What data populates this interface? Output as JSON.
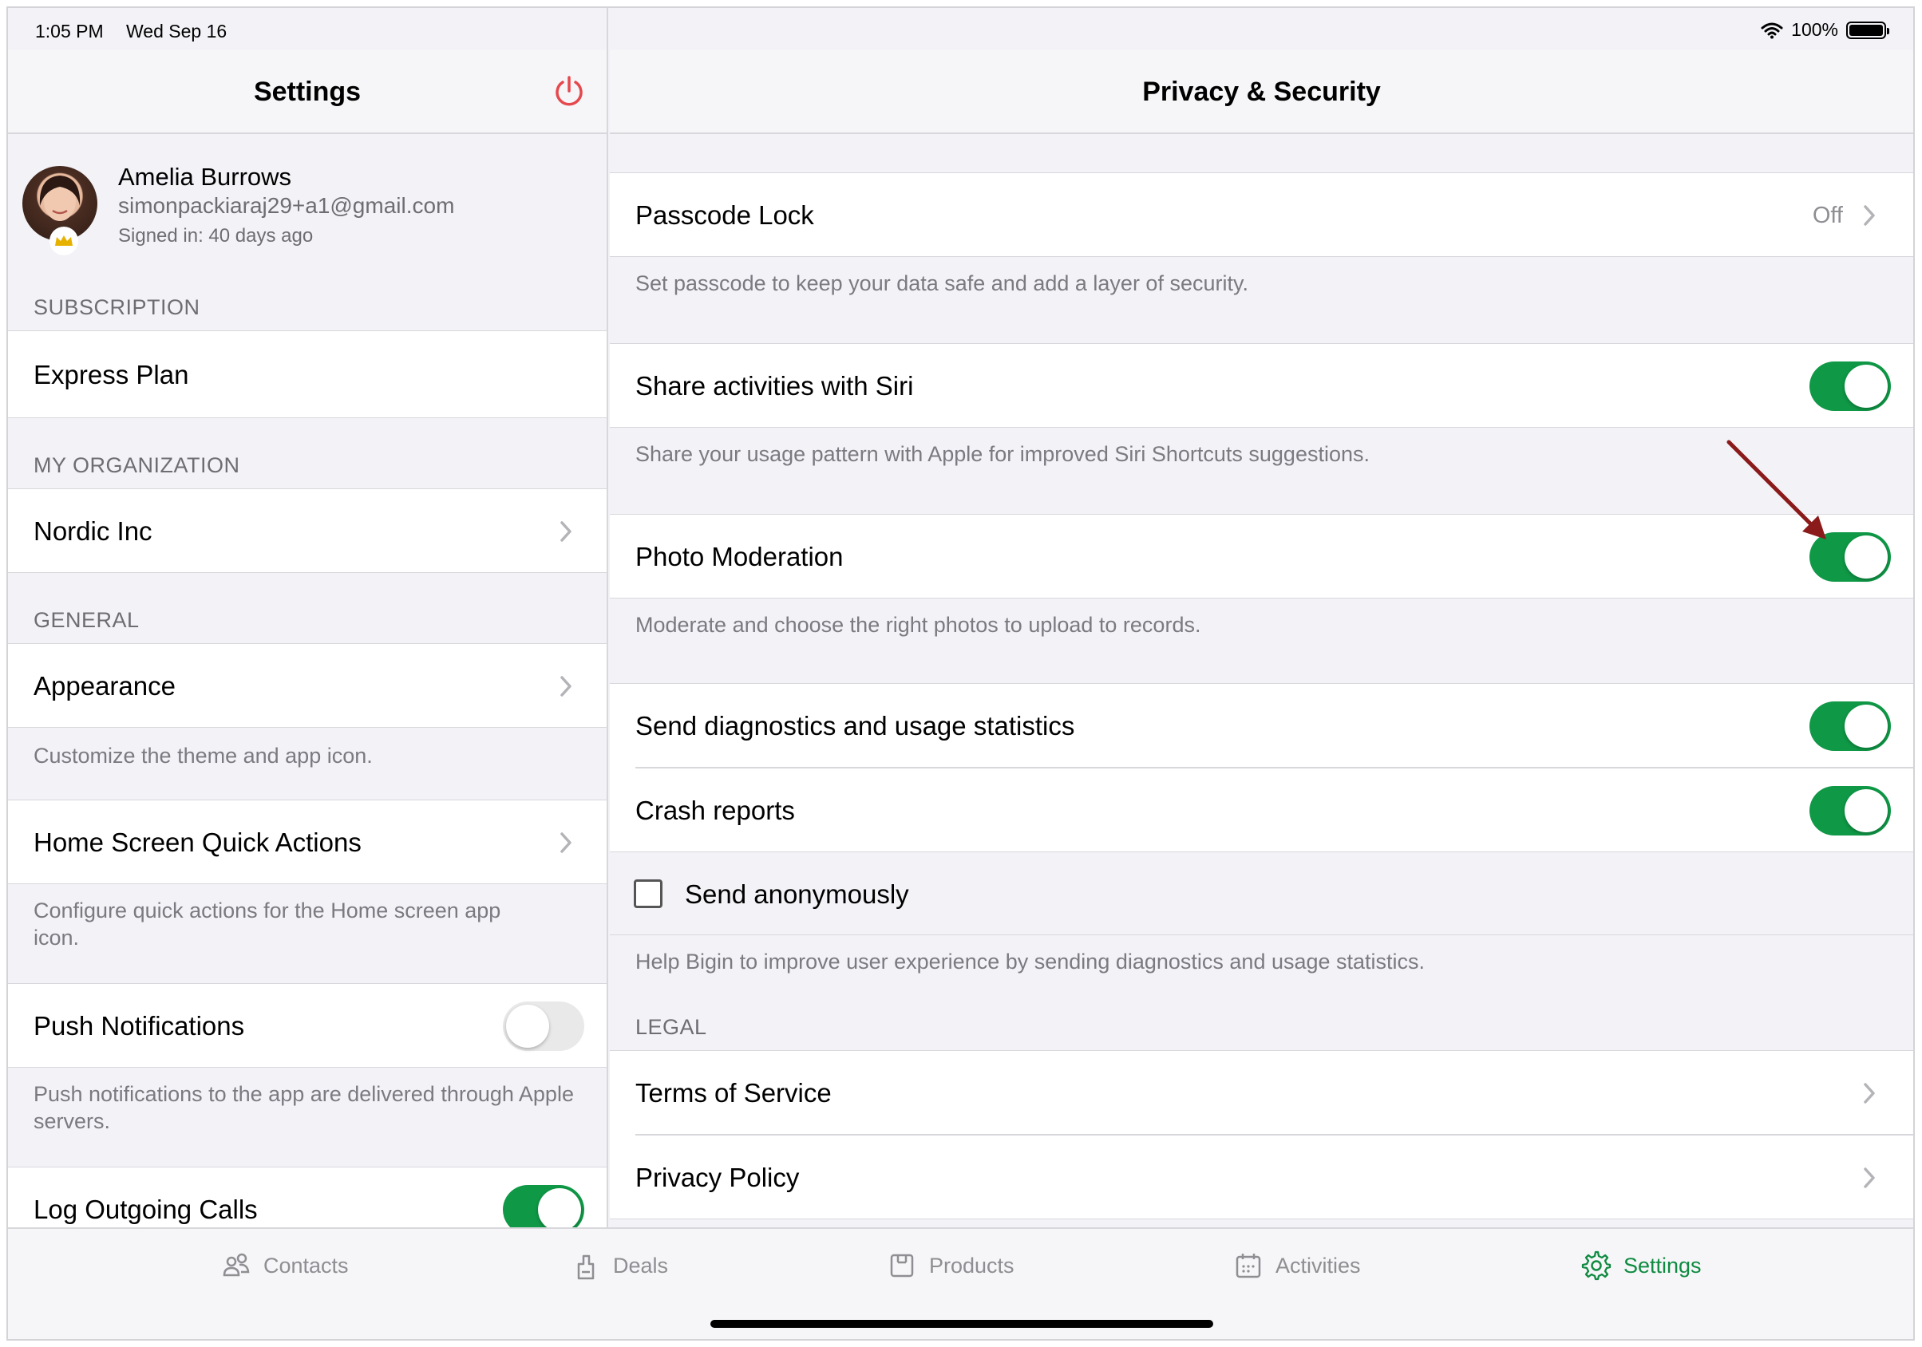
{
  "status_bar": {
    "time": "1:05 PM",
    "date": "Wed Sep 16",
    "battery": "100%"
  },
  "left": {
    "title": "Settings",
    "profile": {
      "name": "Amelia Burrows",
      "email": "simonpackiaraj29+a1@gmail.com",
      "signed_in": "Signed in: 40 days ago"
    },
    "subscription_header": "SUBSCRIPTION",
    "subscription_plan": "Express Plan",
    "org_header": "MY ORGANIZATION",
    "org_name": "Nordic Inc",
    "general_header": "GENERAL",
    "appearance": "Appearance",
    "appearance_footer": "Customize the theme and app icon.",
    "quick_actions": "Home Screen Quick Actions",
    "quick_actions_footer": "Configure quick actions for the Home screen app icon.",
    "push": "Push Notifications",
    "push_toggle": "off",
    "push_footer": "Push notifications to the app are delivered through Apple servers.",
    "log_calls": "Log Outgoing Calls",
    "log_calls_toggle": "on"
  },
  "right": {
    "title": "Privacy & Security",
    "passcode_label": "Passcode Lock",
    "passcode_value": "Off",
    "passcode_footer": "Set passcode to keep your data safe and add a layer of security.",
    "siri_label": "Share activities with Siri",
    "siri_toggle": "on",
    "siri_footer": "Share your usage pattern with Apple for improved Siri Shortcuts suggestions.",
    "photo_label": "Photo Moderation",
    "photo_toggle": "on",
    "photo_footer": "Moderate and choose the right photos to upload to records.",
    "diag_label": "Send diagnostics and usage statistics",
    "diag_toggle": "on",
    "crash_label": "Crash reports",
    "crash_toggle": "on",
    "anon_label": "Send anonymously",
    "anon_checked": false,
    "diag_footer": "Help Bigin to improve user experience by sending diagnostics and usage statistics.",
    "legal_header": "LEGAL",
    "terms": "Terms of Service",
    "privacy": "Privacy Policy"
  },
  "tabs": [
    {
      "label": "Contacts",
      "icon": "contacts-icon",
      "active": false
    },
    {
      "label": "Deals",
      "icon": "deals-icon",
      "active": false
    },
    {
      "label": "Products",
      "icon": "products-icon",
      "active": false
    },
    {
      "label": "Activities",
      "icon": "activities-icon",
      "active": false
    },
    {
      "label": "Settings",
      "icon": "settings-gear-icon",
      "active": true
    }
  ],
  "colors": {
    "accent_green": "#0f9846",
    "power_red": "#e5484d",
    "annotation_arrow": "#8b1a1a"
  }
}
